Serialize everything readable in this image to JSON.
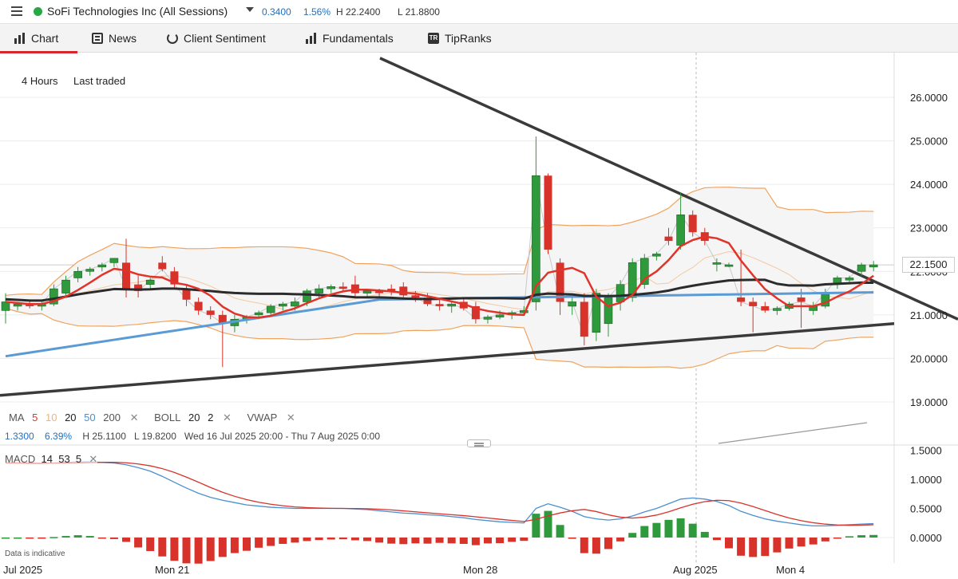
{
  "header": {
    "instrument": "SoFi Technologies Inc (All Sessions)",
    "change": "0.3400",
    "change_pct": "1.56%",
    "high": "H 22.2400",
    "low": "L 21.8800",
    "status_color": "#27a844"
  },
  "tabs": [
    {
      "label": "Chart",
      "icon": "chart-bars-icon",
      "active": true
    },
    {
      "label": "News",
      "icon": "news-icon"
    },
    {
      "label": "Client Sentiment",
      "icon": "sentiment-icon"
    },
    {
      "label": "Fundamentals",
      "icon": "fundamentals-icon"
    },
    {
      "label": "TipRanks",
      "icon": "tipranks-icon"
    }
  ],
  "toolbar": {
    "timeframe": "4 Hours",
    "price_type": "Last traded"
  },
  "price_axis": [
    "26.0000",
    "25.0000",
    "24.0000",
    "23.0000",
    "22.0000",
    "21.0000",
    "20.0000",
    "19.0000"
  ],
  "current_price": "22.1500",
  "indicators": {
    "ma_label": "MA",
    "ma_periods": [
      "5",
      "10",
      "20",
      "50",
      "200"
    ],
    "boll": [
      "BOLL",
      "20",
      "2"
    ],
    "vwap": "VWAP",
    "close": "✕"
  },
  "range": {
    "change": "1.3300",
    "change_pct": "6.39%",
    "high": "H 25.1100",
    "low": "L 19.8200",
    "dates": "Wed 16 Jul 2025 20:00 - Thu 7 Aug 2025 0:00"
  },
  "macd": {
    "label": "MACD",
    "params": [
      "14",
      "53",
      "5"
    ],
    "axis": [
      "1.5000",
      "1.0000",
      "0.5000",
      "0.0000"
    ]
  },
  "time_axis": [
    "Jul 2025",
    "Mon 21",
    "Mon 28",
    "Aug 2025",
    "Mon 4"
  ],
  "footer_note": "Data is indicative",
  "colors": {
    "up": "#2e9a3c",
    "down": "#d8332b",
    "ma5": "#e0342a",
    "ma20": "#2b2b2b",
    "ma50": "#5b9bd5",
    "boll": "#f0a35e"
  },
  "chart_data": {
    "type": "candlestick",
    "y_range": [
      18.8,
      26.6
    ],
    "candles": [
      [
        21.1,
        21.5,
        20.8,
        21.3
      ],
      [
        21.2,
        21.3,
        21.1,
        21.25
      ],
      [
        21.25,
        21.35,
        21.15,
        21.2
      ],
      [
        21.2,
        21.3,
        21.1,
        21.25
      ],
      [
        21.25,
        21.7,
        21.2,
        21.6
      ],
      [
        21.5,
        21.9,
        21.4,
        21.8
      ],
      [
        21.85,
        22.1,
        21.75,
        22.0
      ],
      [
        22.0,
        22.1,
        21.9,
        22.05
      ],
      [
        22.1,
        22.2,
        22.0,
        22.15
      ],
      [
        22.2,
        22.3,
        22.1,
        22.3
      ],
      [
        22.2,
        22.75,
        21.4,
        21.6
      ],
      [
        21.7,
        21.9,
        21.4,
        21.55
      ],
      [
        21.7,
        21.85,
        21.6,
        21.8
      ],
      [
        22.2,
        22.35,
        22.0,
        22.05
      ],
      [
        22.0,
        22.1,
        21.6,
        21.7
      ],
      [
        21.6,
        21.7,
        21.2,
        21.35
      ],
      [
        21.3,
        21.4,
        21.0,
        21.1
      ],
      [
        21.1,
        21.2,
        20.9,
        21.0
      ],
      [
        21.0,
        21.1,
        19.8,
        20.8
      ],
      [
        20.75,
        21.0,
        20.6,
        20.9
      ],
      [
        20.9,
        21.0,
        20.8,
        20.95
      ],
      [
        21.0,
        21.1,
        20.9,
        21.05
      ],
      [
        21.05,
        21.25,
        21.0,
        21.2
      ],
      [
        21.2,
        21.3,
        21.1,
        21.25
      ],
      [
        21.2,
        21.4,
        21.1,
        21.3
      ],
      [
        21.3,
        21.6,
        21.2,
        21.55
      ],
      [
        21.5,
        21.7,
        21.4,
        21.6
      ],
      [
        21.6,
        21.7,
        21.5,
        21.65
      ],
      [
        21.65,
        21.75,
        21.55,
        21.6
      ],
      [
        21.7,
        21.9,
        21.4,
        21.5
      ],
      [
        21.5,
        21.6,
        21.4,
        21.55
      ],
      [
        21.55,
        21.6,
        21.4,
        21.5
      ],
      [
        21.6,
        21.7,
        21.45,
        21.55
      ],
      [
        21.65,
        21.75,
        21.4,
        21.45
      ],
      [
        21.45,
        21.55,
        21.3,
        21.4
      ],
      [
        21.4,
        21.5,
        21.2,
        21.25
      ],
      [
        21.25,
        21.35,
        21.1,
        21.2
      ],
      [
        21.2,
        21.3,
        21.05,
        21.25
      ],
      [
        21.3,
        21.4,
        21.1,
        21.15
      ],
      [
        21.2,
        21.3,
        20.8,
        20.9
      ],
      [
        20.9,
        21.0,
        20.8,
        20.95
      ],
      [
        20.95,
        21.1,
        20.9,
        21.0
      ],
      [
        21.0,
        21.1,
        20.9,
        21.05
      ],
      [
        21.05,
        21.2,
        21.0,
        21.1
      ],
      [
        21.3,
        25.1,
        21.1,
        24.2
      ],
      [
        24.2,
        24.25,
        22.4,
        22.5
      ],
      [
        22.2,
        22.3,
        21.0,
        21.3
      ],
      [
        21.2,
        21.4,
        21.0,
        21.3
      ],
      [
        21.3,
        21.5,
        20.3,
        20.5
      ],
      [
        20.6,
        21.6,
        20.4,
        21.5
      ],
      [
        20.8,
        21.5,
        20.5,
        21.4
      ],
      [
        21.3,
        21.8,
        21.1,
        21.7
      ],
      [
        21.4,
        22.3,
        21.3,
        22.2
      ],
      [
        21.7,
        22.4,
        21.6,
        22.3
      ],
      [
        22.35,
        22.45,
        22.25,
        22.4
      ],
      [
        22.8,
        23.0,
        22.6,
        22.7
      ],
      [
        22.6,
        23.8,
        22.5,
        23.3
      ],
      [
        23.3,
        23.4,
        22.8,
        22.9
      ],
      [
        22.9,
        23.0,
        22.6,
        22.7
      ],
      [
        22.2,
        22.3,
        22.0,
        22.2
      ],
      [
        22.15,
        22.2,
        22.1,
        22.15
      ],
      [
        21.4,
        22.5,
        21.2,
        21.3
      ],
      [
        21.3,
        21.4,
        20.6,
        21.2
      ],
      [
        21.2,
        21.3,
        21.05,
        21.1
      ],
      [
        21.1,
        21.2,
        21.0,
        21.15
      ],
      [
        21.15,
        21.3,
        21.1,
        21.25
      ],
      [
        21.4,
        21.6,
        20.7,
        21.3
      ],
      [
        21.1,
        21.3,
        21.0,
        21.2
      ],
      [
        21.2,
        21.6,
        21.15,
        21.5
      ],
      [
        21.7,
        21.9,
        21.6,
        21.85
      ],
      [
        21.8,
        21.9,
        21.7,
        21.85
      ],
      [
        22.0,
        22.2,
        21.9,
        22.15
      ],
      [
        22.1,
        22.24,
        22.0,
        22.15
      ]
    ]
  }
}
